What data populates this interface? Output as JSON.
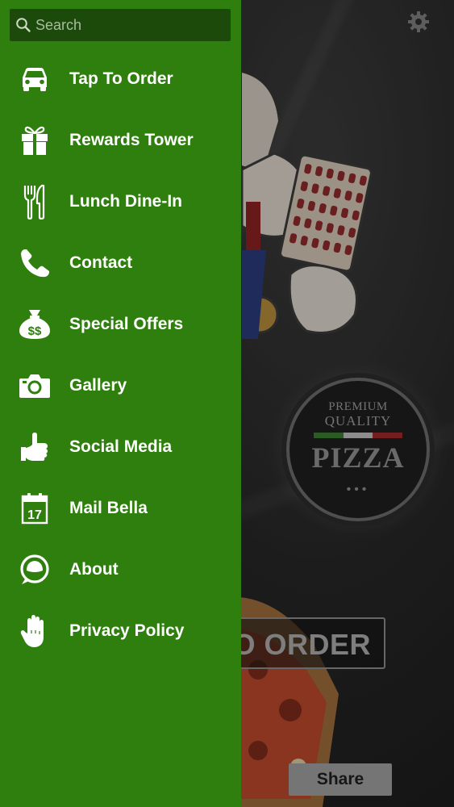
{
  "search": {
    "placeholder": "Search"
  },
  "menu": {
    "items": [
      {
        "label": "Tap To Order",
        "icon": "car-icon"
      },
      {
        "label": "Rewards Tower",
        "icon": "gift-icon"
      },
      {
        "label": "Lunch Dine-In",
        "icon": "fork-knife-icon"
      },
      {
        "label": "Contact",
        "icon": "phone-icon"
      },
      {
        "label": "Special Offers",
        "icon": "money-bag-icon"
      },
      {
        "label": "Gallery",
        "icon": "camera-icon"
      },
      {
        "label": "Social Media",
        "icon": "thumbs-up-icon"
      },
      {
        "label": "Mail Bella",
        "icon": "calendar-icon"
      },
      {
        "label": "About",
        "icon": "speech-bubble-icon"
      },
      {
        "label": "Privacy Policy",
        "icon": "hand-icon"
      }
    ]
  },
  "calendar_day": "17",
  "badge": {
    "line1": "PREMIUM",
    "line2": "QUALITY",
    "line3": "PIZZA",
    "dots": "•••"
  },
  "background": {
    "order_button_label": "TO ORDER",
    "share_button_label": "Share"
  },
  "colors": {
    "drawer_bg": "#2f7f0e",
    "search_bg": "#1c4a0a",
    "menu_text": "#ffffff",
    "flag_green": "#3a7a2e",
    "flag_white": "#bdbdbd",
    "flag_red": "#9a2a2a"
  }
}
